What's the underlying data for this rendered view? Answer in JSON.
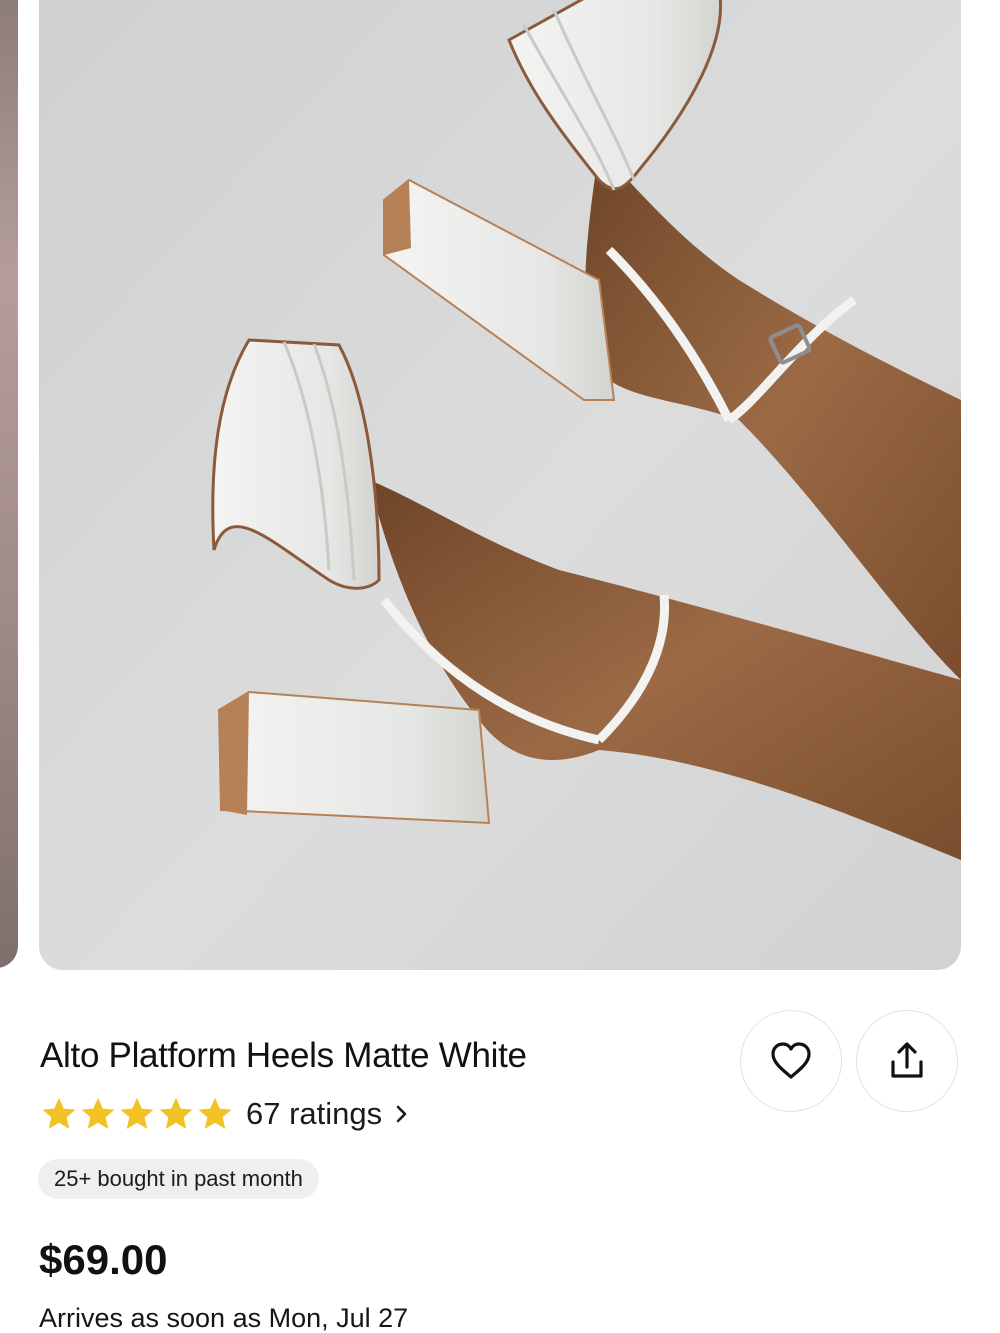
{
  "product": {
    "title": "Alto Platform Heels Matte White",
    "rating": {
      "stars": 5,
      "count_label": "67 ratings"
    },
    "badge": "25+ bought in past month",
    "price": "$69.00",
    "arrival": "Arrives as soon as Mon, Jul 27"
  },
  "actions": {
    "favorite_icon": "heart-icon",
    "share_icon": "share-icon"
  },
  "colors": {
    "star": "#F2C224",
    "text": "#111111",
    "badge_bg": "#EFEFEF",
    "image_bg": "#D9DADB"
  }
}
